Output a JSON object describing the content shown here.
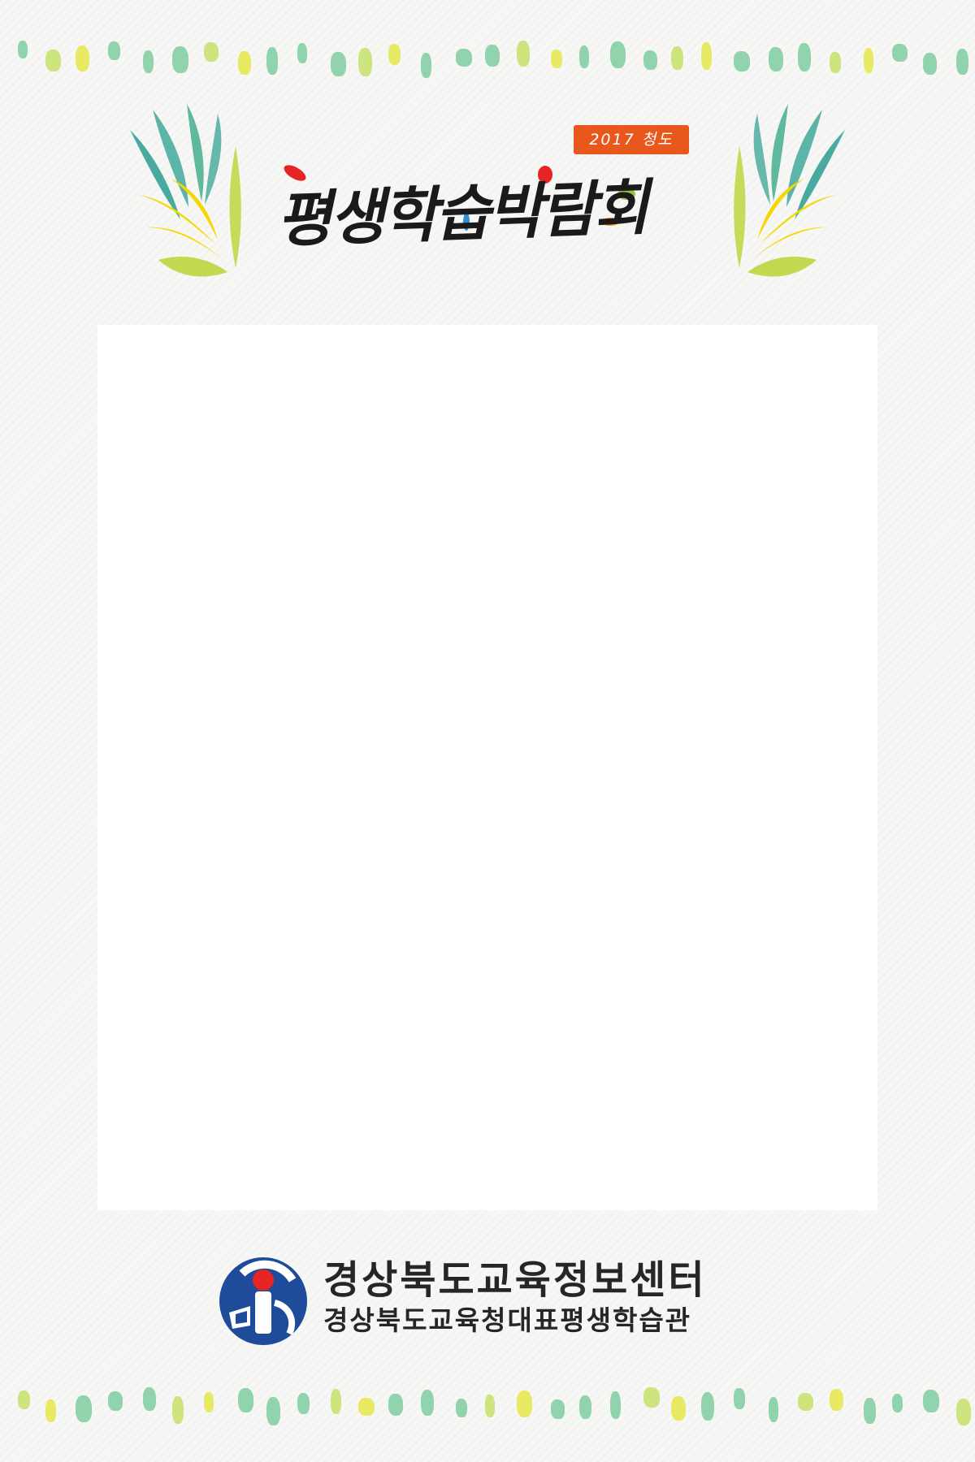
{
  "header": {
    "year_badge": "2017 청도",
    "title": "평생학습박람회"
  },
  "footer": {
    "org_name": "경상북도교육정보센터",
    "org_subtitle": "경상북도교육청대표평생학습관"
  },
  "colors": {
    "badge": "#e8581c",
    "leaf_teal": "#2a9d8f",
    "leaf_yellow": "#f4d800",
    "leaf_lime": "#b8d433",
    "dot_mint": "#7fcca0",
    "dot_lime": "#c5e06a",
    "dot_yellow": "#e6e84a",
    "logo_blue": "#1e4c9a",
    "logo_red": "#e62423"
  },
  "icons": {
    "logo": "education-info-center-logo",
    "leaves": "leaf-sprig-icon"
  }
}
